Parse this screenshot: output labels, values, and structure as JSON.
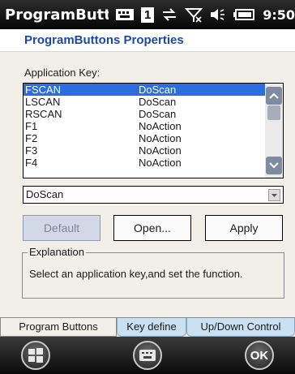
{
  "statusbar": {
    "app_title": "ProgramButtoı",
    "badge_number": "1",
    "time": "9:50",
    "icons": [
      "keyboard-icon",
      "number-badge-icon",
      "connectivity-icon",
      "no-signal-icon",
      "volume-icon",
      "battery-icon"
    ]
  },
  "header": {
    "title": "ProgramButtons Properties"
  },
  "form": {
    "app_key_label": "Application Key:",
    "keys": [
      {
        "key": "FSCAN",
        "action": "DoScan"
      },
      {
        "key": "LSCAN",
        "action": "DoScan"
      },
      {
        "key": "RSCAN",
        "action": "DoScan"
      },
      {
        "key": "F1",
        "action": "NoAction"
      },
      {
        "key": "F2",
        "action": "NoAction"
      },
      {
        "key": "F3",
        "action": "NoAction"
      },
      {
        "key": "F4",
        "action": "NoAction"
      }
    ],
    "selected_action": "DoScan"
  },
  "buttons": {
    "default": "Default",
    "open": "Open...",
    "apply": "Apply"
  },
  "explanation": {
    "legend": "Explanation",
    "text": "Select an application key,and set the function."
  },
  "tabs": [
    {
      "label": "Program Buttons",
      "active": true
    },
    {
      "label": "Key define",
      "active": false
    },
    {
      "label": "Up/Down Control",
      "active": false
    }
  ],
  "bottombar": {
    "ok_label": "OK"
  },
  "colors": {
    "accent": "#1a4aa6",
    "selection": "#2c6ee0",
    "tab_inactive": "#c9e1f2"
  }
}
